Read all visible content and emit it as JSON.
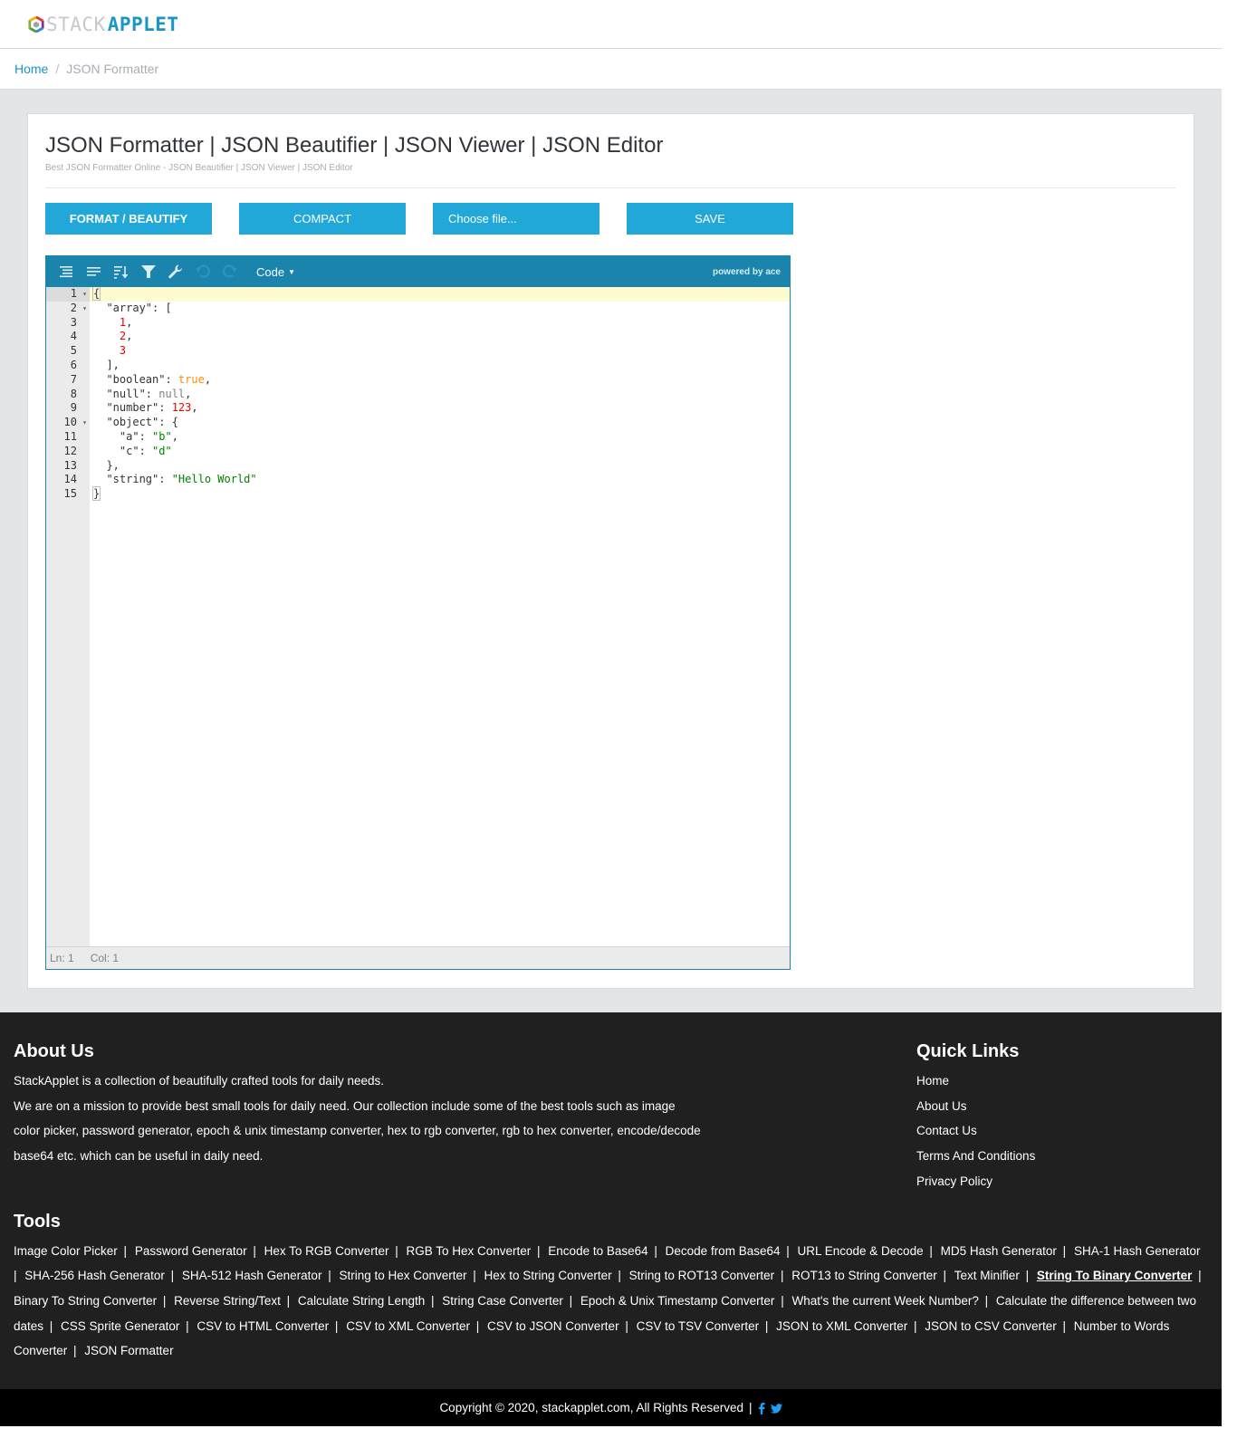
{
  "header": {
    "logo_part1": "STACK",
    "logo_part2": "APPLET"
  },
  "breadcrumb": {
    "home": "Home",
    "separator": "/",
    "current": "JSON Formatter"
  },
  "page": {
    "title": "JSON Formatter | JSON Beautifier | JSON Viewer | JSON Editor",
    "subtitle": "Best JSON Formatter Online - JSON Beautifier | JSON Viewer | JSON Editor"
  },
  "buttons": {
    "format": "FORMAT / BEAUTIFY",
    "compact": "COMPACT",
    "choose_file": "Choose file...",
    "save": "SAVE"
  },
  "editor": {
    "toolbar": {
      "icons": [
        "format-icon",
        "compact-icon",
        "sort-icon",
        "filter-icon",
        "repair-icon",
        "undo-icon",
        "redo-icon"
      ],
      "mode": "Code",
      "powered_by": "powered by ace"
    },
    "lines": [
      {
        "n": "1",
        "fold": true,
        "active": true
      },
      {
        "n": "2",
        "fold": true
      },
      {
        "n": "3"
      },
      {
        "n": "4"
      },
      {
        "n": "5"
      },
      {
        "n": "6"
      },
      {
        "n": "7"
      },
      {
        "n": "8"
      },
      {
        "n": "9"
      },
      {
        "n": "10",
        "fold": true
      },
      {
        "n": "11"
      },
      {
        "n": "12"
      },
      {
        "n": "13"
      },
      {
        "n": "14"
      },
      {
        "n": "15"
      }
    ],
    "code": [
      [
        {
          "t": "{",
          "c": "bracket-hl"
        }
      ],
      [
        {
          "t": "  \"array\": ["
        }
      ],
      [
        {
          "t": "    "
        },
        {
          "t": "1",
          "c": "num"
        },
        {
          "t": ","
        }
      ],
      [
        {
          "t": "    "
        },
        {
          "t": "2",
          "c": "num"
        },
        {
          "t": ","
        }
      ],
      [
        {
          "t": "    "
        },
        {
          "t": "3",
          "c": "num"
        }
      ],
      [
        {
          "t": "  ],"
        }
      ],
      [
        {
          "t": "  \"boolean\": "
        },
        {
          "t": "true",
          "c": "bool"
        },
        {
          "t": ","
        }
      ],
      [
        {
          "t": "  \"null\": "
        },
        {
          "t": "null",
          "c": "null"
        },
        {
          "t": ","
        }
      ],
      [
        {
          "t": "  \"number\": "
        },
        {
          "t": "123",
          "c": "num"
        },
        {
          "t": ","
        }
      ],
      [
        {
          "t": "  \"object\": {"
        }
      ],
      [
        {
          "t": "    \"a\": "
        },
        {
          "t": "\"b\"",
          "c": "str"
        },
        {
          "t": ","
        }
      ],
      [
        {
          "t": "    \"c\": "
        },
        {
          "t": "\"d\"",
          "c": "str"
        }
      ],
      [
        {
          "t": "  },"
        }
      ],
      [
        {
          "t": "  \"string\": "
        },
        {
          "t": "\"Hello World\"",
          "c": "str"
        }
      ],
      [
        {
          "t": "}",
          "c": "bracket-hl"
        }
      ]
    ],
    "status": {
      "line": "Ln: 1",
      "col": "Col: 1"
    }
  },
  "footer": {
    "about": {
      "heading": "About Us",
      "p1": "StackApplet is a collection of beautifully crafted tools for daily needs.",
      "p2": "We are on a mission to provide best small tools for daily need. Our collection include some of the best tools such as image color picker, password generator, epoch & unix timestamp converter, hex to rgb converter, rgb to hex converter, encode/decode base64 etc. which can be useful in daily need."
    },
    "quick_links": {
      "heading": "Quick Links",
      "items": [
        "Home",
        "About Us",
        "Contact Us",
        "Terms And Conditions",
        "Privacy Policy"
      ]
    },
    "tools": {
      "heading": "Tools",
      "items": [
        "Image Color Picker",
        "Password Generator",
        "Hex To RGB Converter",
        "RGB To Hex Converter",
        "Encode to Base64",
        "Decode from Base64",
        "URL Encode & Decode",
        "MD5 Hash Generator",
        "SHA-1 Hash Generator",
        "SHA-256 Hash Generator",
        "SHA-512 Hash Generator",
        "String to Hex Converter",
        "Hex to String Converter",
        "String to ROT13 Converter",
        "ROT13 to String Converter",
        "Text Minifier",
        "String To Binary Converter",
        "Binary To String Converter",
        "Reverse String/Text",
        "Calculate String Length",
        "String Case Converter",
        "Epoch & Unix Timestamp Converter",
        "What's the current Week Number?",
        "Calculate the difference between two dates",
        "CSS Sprite Generator",
        "CSV to HTML Converter",
        "CSV to XML Converter",
        "CSV to JSON Converter",
        "CSV to TSV Converter",
        "JSON to XML Converter",
        "JSON to CSV Converter",
        "Number to Words Converter",
        "JSON Formatter"
      ],
      "highlighted": "String To Binary Converter"
    },
    "copyright": "Copyright © 2020, stackapplet.com, All Rights Reserved",
    "copyright_sep": "|",
    "social": [
      "facebook-icon",
      "twitter-icon"
    ]
  }
}
